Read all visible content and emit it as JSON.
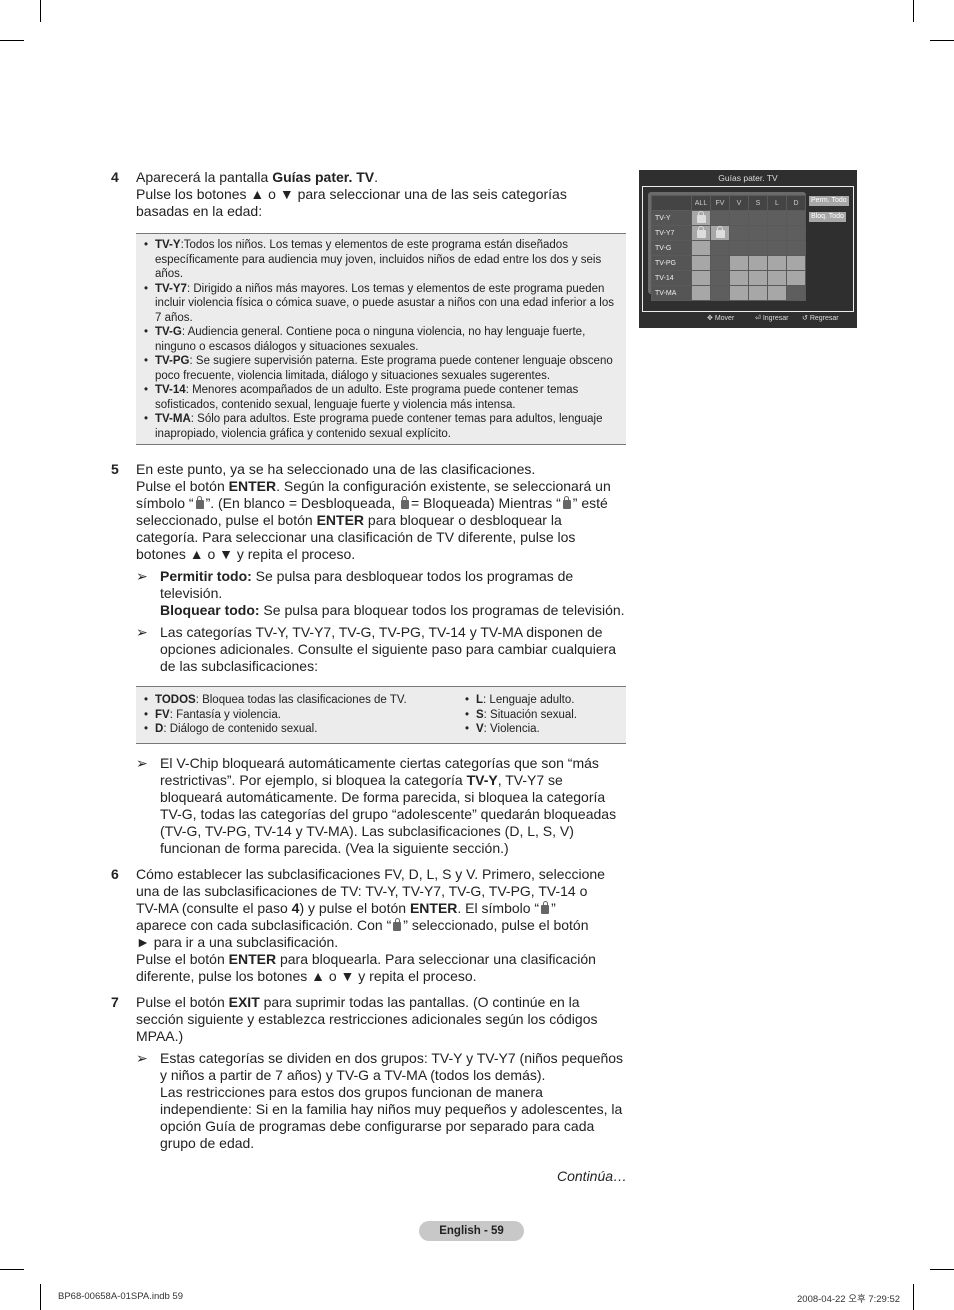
{
  "step4": {
    "number": "4",
    "line1_pre": "Aparecerá la pantalla ",
    "line1_bold": "Guías pater. TV",
    "line1_post": ".",
    "line2": "Pulse los botones ▲ o ▼ para seleccionar una de las seis categorías basadas en la edad:"
  },
  "ratings_box": [
    {
      "term": "TV-Y",
      "desc": ":Todos los niños. Los temas y elementos de este programa están diseñados específicamente para audiencia muy joven, incluidos niños de edad entre los dos y seis años."
    },
    {
      "term": "TV-Y7",
      "desc": ": Dirigido a niños más mayores. Los temas y elementos de este programa pueden incluir violencia física o cómica suave, o puede asustar a niños con una edad inferior a los 7 años."
    },
    {
      "term": "TV-G",
      "desc": ": Audiencia general. Contiene poca o ninguna violencia, no hay lenguaje fuerte, ninguno o escasos diálogos y situaciones sexuales."
    },
    {
      "term": "TV-PG",
      "desc": ": Se sugiere supervisión paterna. Este programa puede contener lenguaje obsceno poco frecuente, violencia limitada, diálogo y situaciones sexuales sugerentes."
    },
    {
      "term": "TV-14",
      "desc": ": Menores acompañados de un adulto. Este programa puede contener temas sofisticados, contenido sexual, lenguaje fuerte y violencia más intensa."
    },
    {
      "term": "TV-MA",
      "desc": ": Sólo para adultos. Este programa puede contener temas para adultos, lenguaje inapropiado, violencia gráfica y contenido sexual explícito."
    }
  ],
  "step5": {
    "number": "5",
    "t1": "En este punto, ya se ha seleccionado una de las clasificaciones.",
    "t2": "Pulse el botón ",
    "enter": "ENTER",
    "t3": ". Según la configuración existente, se seleccionará un símbolo “",
    "t4": "”. (En blanco = Desbloqueada, ",
    "t5": "= Bloqueada) Mientras “",
    "t6": "” esté seleccionado, pulse el botón ",
    "t7": " para bloquear o desbloquear la categoría. Para seleccionar una clasificación de TV diferente, pulse los botones ▲ o ▼ y repita el proceso.",
    "note1_bold": "Permitir todo:",
    "note1_text": " Se pulsa para desbloquear todos los programas de televisión.",
    "note1b_bold": "Bloquear todo:",
    "note1b_text": " Se pulsa para bloquear todos los programas de televisión.",
    "note2": "Las categorías TV-Y, TV-Y7, TV-G, TV-PG, TV-14 y TV-MA disponen de opciones adicionales. Consulte el siguiente paso para cambiar cualquiera de las subclasificaciones:"
  },
  "sub_box": {
    "left": [
      {
        "term": "TODOS",
        "desc": ": Bloquea todas las clasificaciones de TV."
      },
      {
        "term": "FV",
        "desc": ": Fantasía y violencia."
      },
      {
        "term": "D",
        "desc": ": Diálogo de contenido sexual."
      }
    ],
    "right": [
      {
        "term": "L",
        "desc": ": Lenguaje adulto."
      },
      {
        "term": "S",
        "desc": ": Situación sexual."
      },
      {
        "term": "V",
        "desc": ": Violencia."
      }
    ]
  },
  "vchip_note": {
    "t1": "El V-Chip bloqueará automáticamente ciertas categorías que son “más restrictivas”. Por ejemplo, si bloquea la categoría ",
    "bold": "TV-Y",
    "t2": ", TV-Y7 se bloqueará automáticamente. De forma parecida, si bloquea la categoría TV-G, todas las categorías del grupo “adolescente” quedarán bloqueadas (TV-G, TV-PG, TV-14 y TV-MA). Las subclasificaciones (D, L, S, V) funcionan de forma parecida. (Vea la siguiente sección.)"
  },
  "step6": {
    "number": "6",
    "t1": "Cómo establecer las subclasificaciones FV, D, L, S y V. Primero, seleccione una de las subclasificaciones de TV: TV-Y, TV-Y7, TV-G, TV-PG, TV-14 o TV-MA (consulte el paso ",
    "b1": "4",
    "t2": ") y pulse el botón ",
    "b2": "ENTER",
    "t3": ". El símbolo “",
    "t4": "” aparece con cada subclasificación. Con “",
    "t5": "” seleccionado, pulse el botón ► para ir a una subclasificación.",
    "t6": "Pulse el botón ",
    "b3": "ENTER",
    "t7": " para bloquearla. Para seleccionar una clasificación diferente, pulse los botones ▲ o ▼ y repita el proceso."
  },
  "step7": {
    "number": "7",
    "t1": "Pulse el botón ",
    "b1": "EXIT",
    "t2": " para suprimir todas las pantallas. (O continúe en la sección siguiente y establezca restricciones adicionales según los códigos MPAA.)",
    "note1": "Estas categorías se dividen en dos grupos: TV-Y y TV-Y7 (niños pequeños y niños a partir de 7 años) y TV-G a TV-MA (todos los demás).",
    "note2": "Las restricciones para estos dos grupos funcionan de manera independiente: Si en la familia hay niños muy pequeños y adolescentes, la opción Guía de programas debe configurarse por separado para cada grupo de edad."
  },
  "tv_screen": {
    "title": "Guías pater. TV",
    "columns": [
      "ALL",
      "FV",
      "V",
      "S",
      "L",
      "D"
    ],
    "rows": [
      {
        "label": "TV-Y",
        "cells": [
          "locked",
          "na",
          "na",
          "na",
          "na",
          "na"
        ]
      },
      {
        "label": "TV-Y7",
        "cells": [
          "locked",
          "locked",
          "na",
          "na",
          "na",
          "na"
        ]
      },
      {
        "label": "TV-G",
        "cells": [
          "open",
          "na",
          "na",
          "na",
          "na",
          "na"
        ]
      },
      {
        "label": "TV-PG",
        "cells": [
          "open",
          "na",
          "open",
          "open",
          "open",
          "open"
        ]
      },
      {
        "label": "TV-14",
        "cells": [
          "open",
          "na",
          "open",
          "open",
          "open",
          "open"
        ]
      },
      {
        "label": "TV-MA",
        "cells": [
          "open",
          "na",
          "open",
          "open",
          "open",
          "na"
        ]
      }
    ],
    "allow_all": "Perm. Todo",
    "block_all": "Bloq. Todo",
    "footer": {
      "move": "Mover",
      "enter": "Ingresar",
      "return": "Regresar"
    }
  },
  "continue_label": "Continúa…",
  "page_label": "English - 59",
  "slug_left": "BP68-00658A-01SPA.indb   59",
  "slug_right": "2008-04-22   오후 7:29:52"
}
